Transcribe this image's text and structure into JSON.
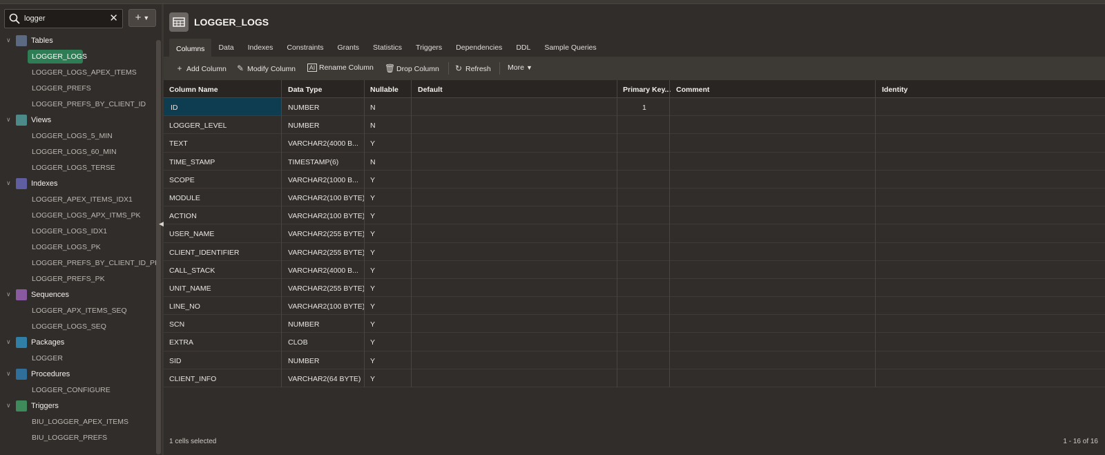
{
  "search": {
    "value": "logger",
    "add_label": "+"
  },
  "tree": [
    {
      "group": "Tables",
      "icon": "table-icon",
      "color": "#5b6a80",
      "items": [
        "LOGGER_LOGS",
        "LOGGER_LOGS_APEX_ITEMS",
        "LOGGER_PREFS",
        "LOGGER_PREFS_BY_CLIENT_ID"
      ],
      "selected": 0
    },
    {
      "group": "Views",
      "icon": "view-icon",
      "color": "#4c8a8a",
      "items": [
        "LOGGER_LOGS_5_MIN",
        "LOGGER_LOGS_60_MIN",
        "LOGGER_LOGS_TERSE"
      ]
    },
    {
      "group": "Indexes",
      "icon": "index-icon",
      "color": "#5e5ea0",
      "items": [
        "LOGGER_APEX_ITEMS_IDX1",
        "LOGGER_LOGS_APX_ITMS_PK",
        "LOGGER_LOGS_IDX1",
        "LOGGER_LOGS_PK",
        "LOGGER_PREFS_BY_CLIENT_ID_PK",
        "LOGGER_PREFS_PK"
      ]
    },
    {
      "group": "Sequences",
      "icon": "sequence-icon",
      "color": "#8a5aa0",
      "items": [
        "LOGGER_APX_ITEMS_SEQ",
        "LOGGER_LOGS_SEQ"
      ]
    },
    {
      "group": "Packages",
      "icon": "package-icon",
      "color": "#2f7fa6",
      "items": [
        "LOGGER"
      ]
    },
    {
      "group": "Procedures",
      "icon": "procedure-icon",
      "color": "#2f6f9a",
      "items": [
        "LOGGER_CONFIGURE"
      ]
    },
    {
      "group": "Triggers",
      "icon": "trigger-icon",
      "color": "#3f8a5a",
      "items": [
        "BIU_LOGGER_APEX_ITEMS",
        "BIU_LOGGER_PREFS"
      ]
    }
  ],
  "header": {
    "title": "LOGGER_LOGS"
  },
  "tabs": [
    "Columns",
    "Data",
    "Indexes",
    "Constraints",
    "Grants",
    "Statistics",
    "Triggers",
    "Dependencies",
    "DDL",
    "Sample Queries"
  ],
  "toolbar": {
    "add_column": "Add Column",
    "modify_column": "Modify Column",
    "rename_column": "Rename Column",
    "drop_column": "Drop Column",
    "refresh": "Refresh",
    "more": "More"
  },
  "grid": {
    "headers": [
      "Column Name",
      "Data Type",
      "Nullable",
      "Default",
      "Primary Key...",
      "Comment",
      "Identity"
    ],
    "rows": [
      [
        "ID",
        "NUMBER",
        "N",
        "",
        "1",
        "",
        ""
      ],
      [
        "LOGGER_LEVEL",
        "NUMBER",
        "N",
        "",
        "",
        "",
        ""
      ],
      [
        "TEXT",
        "VARCHAR2(4000 B...",
        "Y",
        "",
        "",
        "",
        ""
      ],
      [
        "TIME_STAMP",
        "TIMESTAMP(6)",
        "N",
        "",
        "",
        "",
        ""
      ],
      [
        "SCOPE",
        "VARCHAR2(1000 B...",
        "Y",
        "",
        "",
        "",
        ""
      ],
      [
        "MODULE",
        "VARCHAR2(100 BYTE)",
        "Y",
        "",
        "",
        "",
        ""
      ],
      [
        "ACTION",
        "VARCHAR2(100 BYTE)",
        "Y",
        "",
        "",
        "",
        ""
      ],
      [
        "USER_NAME",
        "VARCHAR2(255 BYTE)",
        "Y",
        "",
        "",
        "",
        ""
      ],
      [
        "CLIENT_IDENTIFIER",
        "VARCHAR2(255 BYTE)",
        "Y",
        "",
        "",
        "",
        ""
      ],
      [
        "CALL_STACK",
        "VARCHAR2(4000 B...",
        "Y",
        "",
        "",
        "",
        ""
      ],
      [
        "UNIT_NAME",
        "VARCHAR2(255 BYTE)",
        "Y",
        "",
        "",
        "",
        ""
      ],
      [
        "LINE_NO",
        "VARCHAR2(100 BYTE)",
        "Y",
        "",
        "",
        "",
        ""
      ],
      [
        "SCN",
        "NUMBER",
        "Y",
        "",
        "",
        "",
        ""
      ],
      [
        "EXTRA",
        "CLOB",
        "Y",
        "",
        "",
        "",
        ""
      ],
      [
        "SID",
        "NUMBER",
        "Y",
        "",
        "",
        "",
        ""
      ],
      [
        "CLIENT_INFO",
        "VARCHAR2(64 BYTE)",
        "Y",
        "",
        "",
        "",
        ""
      ]
    ]
  },
  "footer": {
    "selection": "1 cells selected",
    "range": "1 - 16 of 16"
  }
}
